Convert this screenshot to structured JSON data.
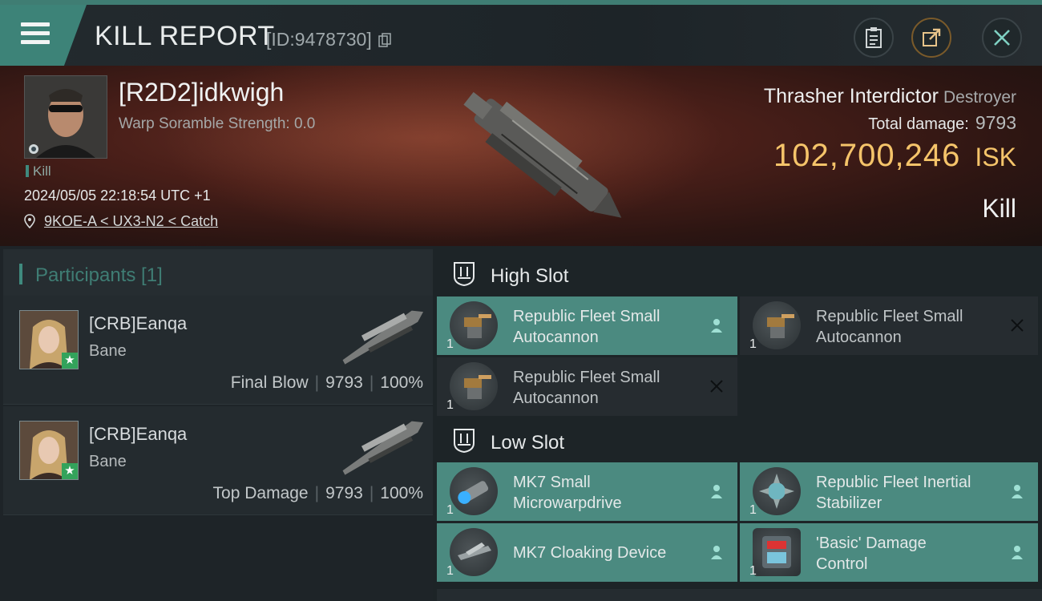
{
  "header": {
    "title": "KILL REPORT",
    "report_id": "[ID:9478730]",
    "menu_icon": "hamburger-icon",
    "buttons": [
      "clipboard-icon",
      "share-icon",
      "close-icon"
    ]
  },
  "victim": {
    "name": "[R2D2]idkwigh",
    "warp_scramble": "Warp Soramble Strength: 0.0",
    "tag": "Kill",
    "timestamp": "2024/05/05 22:18:54 UTC +1",
    "location": "9KOE-A < UX3-N2 < Catch",
    "ship_name": "Thrasher Interdictor",
    "ship_class": "Destroyer",
    "total_damage_label": "Total damage:",
    "total_damage": "9793",
    "isk_value": "102,700,246",
    "isk_unit": "ISK",
    "result": "Kill"
  },
  "participants": {
    "header": "Participants [1]",
    "rows": [
      {
        "name": "[CRB]Eanqa",
        "ship": "Bane",
        "role": "Final Blow",
        "damage": "9793",
        "percent": "100%"
      },
      {
        "name": "[CRB]Eanqa",
        "ship": "Bane",
        "role": "Top Damage",
        "damage": "9793",
        "percent": "100%"
      }
    ]
  },
  "slots": {
    "high": {
      "label": "High Slot",
      "modules": [
        {
          "name_line1": "Republic Fleet Small",
          "name_line2": "Autocannon",
          "qty": "1",
          "state": "dropped"
        },
        {
          "name_line1": "Republic Fleet Small",
          "name_line2": "Autocannon",
          "qty": "1",
          "state": "destroyed"
        },
        {
          "name_line1": "Republic Fleet Small",
          "name_line2": "Autocannon",
          "qty": "1",
          "state": "destroyed"
        }
      ]
    },
    "low": {
      "label": "Low Slot",
      "modules": [
        {
          "name_line1": "MK7 Small",
          "name_line2": "Microwarpdrive",
          "qty": "1",
          "state": "dropped"
        },
        {
          "name_line1": "Republic Fleet Inertial",
          "name_line2": "Stabilizer",
          "qty": "1",
          "state": "dropped"
        },
        {
          "name_line1": "MK7 Cloaking Device",
          "name_line2": "",
          "qty": "1",
          "state": "dropped"
        },
        {
          "name_line1": "'Basic' Damage",
          "name_line2": "Control",
          "qty": "1",
          "state": "dropped"
        }
      ]
    }
  },
  "colors": {
    "accent": "#3d8378",
    "isk_gold": "#f5c46a",
    "dropped_bg": "#4b8a80",
    "destroyed_bg": "#262c30"
  }
}
